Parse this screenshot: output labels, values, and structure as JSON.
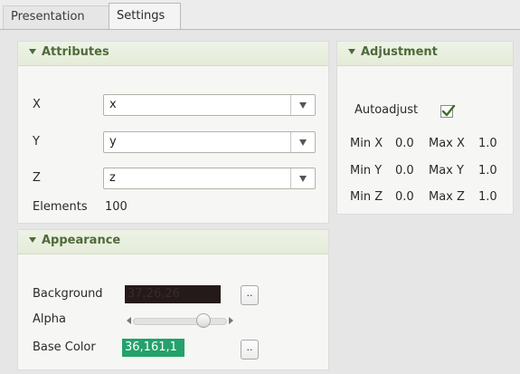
{
  "tabs": [
    "Presentation",
    "Settings"
  ],
  "attributes": {
    "title": "Attributes",
    "x_label": "X",
    "x_value": "x",
    "y_label": "Y",
    "y_value": "y",
    "z_label": "Z",
    "z_value": "z",
    "elements_label": "Elements",
    "elements_value": "100"
  },
  "adjustment": {
    "title": "Adjustment",
    "autoadjust_label": "Autoadjust",
    "autoadjust_checked": true,
    "min_x_label": "Min X",
    "min_x": "0.0",
    "max_x_label": "Max X",
    "max_x": "1.0",
    "min_y_label": "Min Y",
    "min_y": "0.0",
    "max_y_label": "Max Y",
    "max_y": "1.0",
    "min_z_label": "Min Z",
    "min_z": "0.0",
    "max_z_label": "Max Z",
    "max_z": "1.0"
  },
  "appearance": {
    "title": "Appearance",
    "background_label": "Background",
    "background_value": "37,26,26",
    "background_color": "#251a1a",
    "background_text_color": "#3a2a2a",
    "picker_label": "..",
    "alpha_label": "Alpha",
    "alpha_value": 0.75,
    "base_color_label": "Base Color",
    "base_color_value": "36,161,1",
    "base_color": "#24a16c",
    "base_text_color": "#ffffff"
  }
}
